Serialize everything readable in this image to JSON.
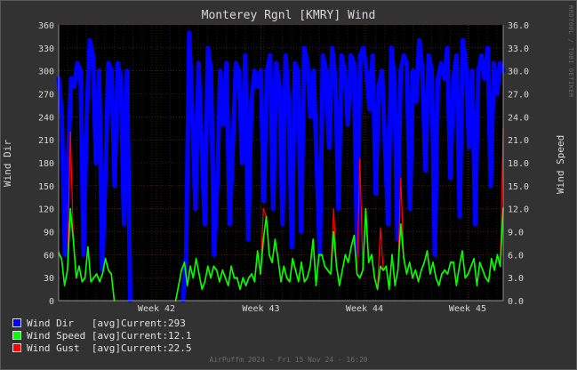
{
  "chart_data": {
    "type": "line",
    "title": "Monterey Rgnl [KMRY] Wind",
    "ylabel_left": "Wind Dir",
    "ylabel_right": "Wind Speed",
    "ylim_left": [
      0,
      360
    ],
    "ylim_right": [
      0,
      36
    ],
    "yticks_left": [
      "0",
      "30",
      "60",
      "90",
      "120",
      "150",
      "180",
      "210",
      "240",
      "270",
      "300",
      "330",
      "360"
    ],
    "yticks_right": [
      "0.0",
      "3.0",
      "6.0",
      "9.0",
      "12.0",
      "15.0",
      "18.0",
      "21.0",
      "24.0",
      "27.0",
      "30.0",
      "33.0",
      "36.0"
    ],
    "xticks": [
      "Week 42",
      "Week 43",
      "Week 44",
      "Week 45"
    ],
    "grid": true,
    "series": [
      {
        "name": "Wind Dir",
        "color": "#0000ff",
        "current": "293",
        "values": [
          290,
          240,
          60,
          180,
          290,
          280,
          310,
          300,
          60,
          240,
          340,
          320,
          180,
          300,
          40,
          160,
          310,
          300,
          150,
          310,
          290,
          100,
          300,
          0,
          0,
          0,
          0,
          0,
          0,
          0,
          0,
          0,
          0,
          0,
          0,
          0,
          0,
          0,
          0,
          0,
          0,
          60,
          350,
          240,
          120,
          310,
          200,
          100,
          330,
          300,
          60,
          150,
          300,
          230,
          310,
          100,
          200,
          310,
          300,
          180,
          320,
          80,
          260,
          300,
          280,
          300,
          130,
          300,
          320,
          120,
          310,
          280,
          100,
          320,
          260,
          70,
          310,
          300,
          90,
          330,
          310,
          240,
          300,
          180,
          60,
          320,
          300,
          200,
          330,
          290,
          120,
          320,
          300,
          230,
          320,
          310,
          60,
          320,
          330,
          300,
          250,
          320,
          140,
          280,
          300,
          200,
          100,
          330,
          290,
          80,
          300,
          320,
          310,
          120,
          300,
          260,
          340,
          300,
          170,
          320,
          300,
          60,
          290,
          310,
          290,
          330,
          160,
          290,
          320,
          110,
          340,
          310,
          200,
          300,
          100,
          300,
          320,
          290,
          330,
          150,
          310,
          270,
          310,
          300
        ]
      },
      {
        "name": "Wind Speed",
        "color": "#00ff00",
        "current": "12.1",
        "values": [
          6.2,
          5.5,
          2.0,
          4.0,
          12.0,
          8.0,
          3.0,
          4.5,
          2.5,
          3.0,
          7.0,
          2.5,
          3.0,
          3.5,
          2.5,
          3.5,
          5.5,
          4.0,
          3.5,
          0,
          0,
          0,
          0,
          0,
          0,
          0,
          0,
          0,
          0,
          0,
          0,
          0,
          0,
          0,
          0,
          0,
          0,
          0,
          0,
          0,
          0,
          2.0,
          4.0,
          5.0,
          2.0,
          4.5,
          3.0,
          5.5,
          3.5,
          1.5,
          2.5,
          4.5,
          3.0,
          4.5,
          4.0,
          2.5,
          4.0,
          3.0,
          2.0,
          4.5,
          3.0,
          3.0,
          1.5,
          3.0,
          2.0,
          3.0,
          3.5,
          2.5,
          6.5,
          3.5,
          8.0,
          11.0,
          6.0,
          5.0,
          8.0,
          5.5,
          2.5,
          4.5,
          3.0,
          2.5,
          5.5,
          4.0,
          2.5,
          5.0,
          2.5,
          3.0,
          4.5,
          8.0,
          2.0,
          6.0,
          6.0,
          4.5,
          4.0,
          3.5,
          9.0,
          4.5,
          2.0,
          4.0,
          6.0,
          5.0,
          7.0,
          8.5,
          3.5,
          3.0,
          4.0,
          12.0,
          5.0,
          6.0,
          3.0,
          1.5,
          4.5,
          4.0,
          4.5,
          1.5,
          6.0,
          2.0,
          4.0,
          10.0,
          5.5,
          3.5,
          5.0,
          3.0,
          4.0,
          2.5,
          4.0,
          5.0,
          6.5,
          3.5,
          5.0,
          3.0,
          2.0,
          3.5,
          4.0,
          3.5,
          5.0,
          5.0,
          2.0,
          4.5,
          6.5,
          3.0,
          3.5,
          4.5,
          5.5,
          2.0,
          5.0,
          4.0,
          3.0,
          2.5,
          5.5,
          4.0,
          6.0,
          4.5,
          12.1
        ]
      },
      {
        "name": "Wind Gust",
        "color": "#ff0000",
        "current": "22.5",
        "values": [
          6.5,
          5.5,
          2.0,
          4.0,
          22.0,
          8.0,
          3.0,
          4.5,
          2.5,
          3.0,
          7.0,
          2.5,
          3.0,
          3.5,
          2.5,
          3.5,
          5.5,
          4.0,
          3.5,
          0,
          0,
          0,
          0,
          0,
          0,
          0,
          0,
          0,
          0,
          0,
          0,
          0,
          0,
          0,
          0,
          0,
          0,
          0,
          0,
          0,
          0,
          2.0,
          4.0,
          5.0,
          2.0,
          4.5,
          3.0,
          5.5,
          3.5,
          1.5,
          2.5,
          4.5,
          3.0,
          4.5,
          4.0,
          2.5,
          4.0,
          3.0,
          2.0,
          4.5,
          3.0,
          3.0,
          1.5,
          3.0,
          2.0,
          3.0,
          3.5,
          2.5,
          6.5,
          3.5,
          12.0,
          11.0,
          6.0,
          5.0,
          8.0,
          5.5,
          2.5,
          4.5,
          3.0,
          2.5,
          5.5,
          4.0,
          2.5,
          5.0,
          2.5,
          3.0,
          4.5,
          8.0,
          2.0,
          6.0,
          6.0,
          4.5,
          4.0,
          3.5,
          12.0,
          4.5,
          2.0,
          4.0,
          6.0,
          5.0,
          7.0,
          8.5,
          3.5,
          18.5,
          4.0,
          12.0,
          5.0,
          6.0,
          3.0,
          1.5,
          9.5,
          4.0,
          4.5,
          1.5,
          6.0,
          2.0,
          4.0,
          16.0,
          5.5,
          3.5,
          5.0,
          3.0,
          4.0,
          2.5,
          4.0,
          5.0,
          6.5,
          3.5,
          5.0,
          3.0,
          2.0,
          3.5,
          4.0,
          3.5,
          5.0,
          5.0,
          2.0,
          4.5,
          6.5,
          3.0,
          3.5,
          4.5,
          5.5,
          2.0,
          5.0,
          4.0,
          3.0,
          2.5,
          5.5,
          4.0,
          6.0,
          4.5,
          22.5
        ]
      }
    ]
  },
  "legend": [
    {
      "label": "Wind Dir   [avg]",
      "current_label": "Current:",
      "current": "293",
      "color": "#0000ff"
    },
    {
      "label": "Wind Speed [avg]",
      "current_label": "Current:",
      "current": "12.1",
      "color": "#00ff00"
    },
    {
      "label": "Wind Gust  [avg]",
      "current_label": "Current:",
      "current": "22.5",
      "color": "#ff0000"
    }
  ],
  "watermark": "RRDTOOL / TOBI OETIKER",
  "footer": "AirPuffm 2024 - Fri 15 Nov 24 - 16:20",
  "colors": {
    "plot_bg": "#000000",
    "grid_major": "#7a2a1a",
    "grid_minor": "#3a3a3a"
  }
}
